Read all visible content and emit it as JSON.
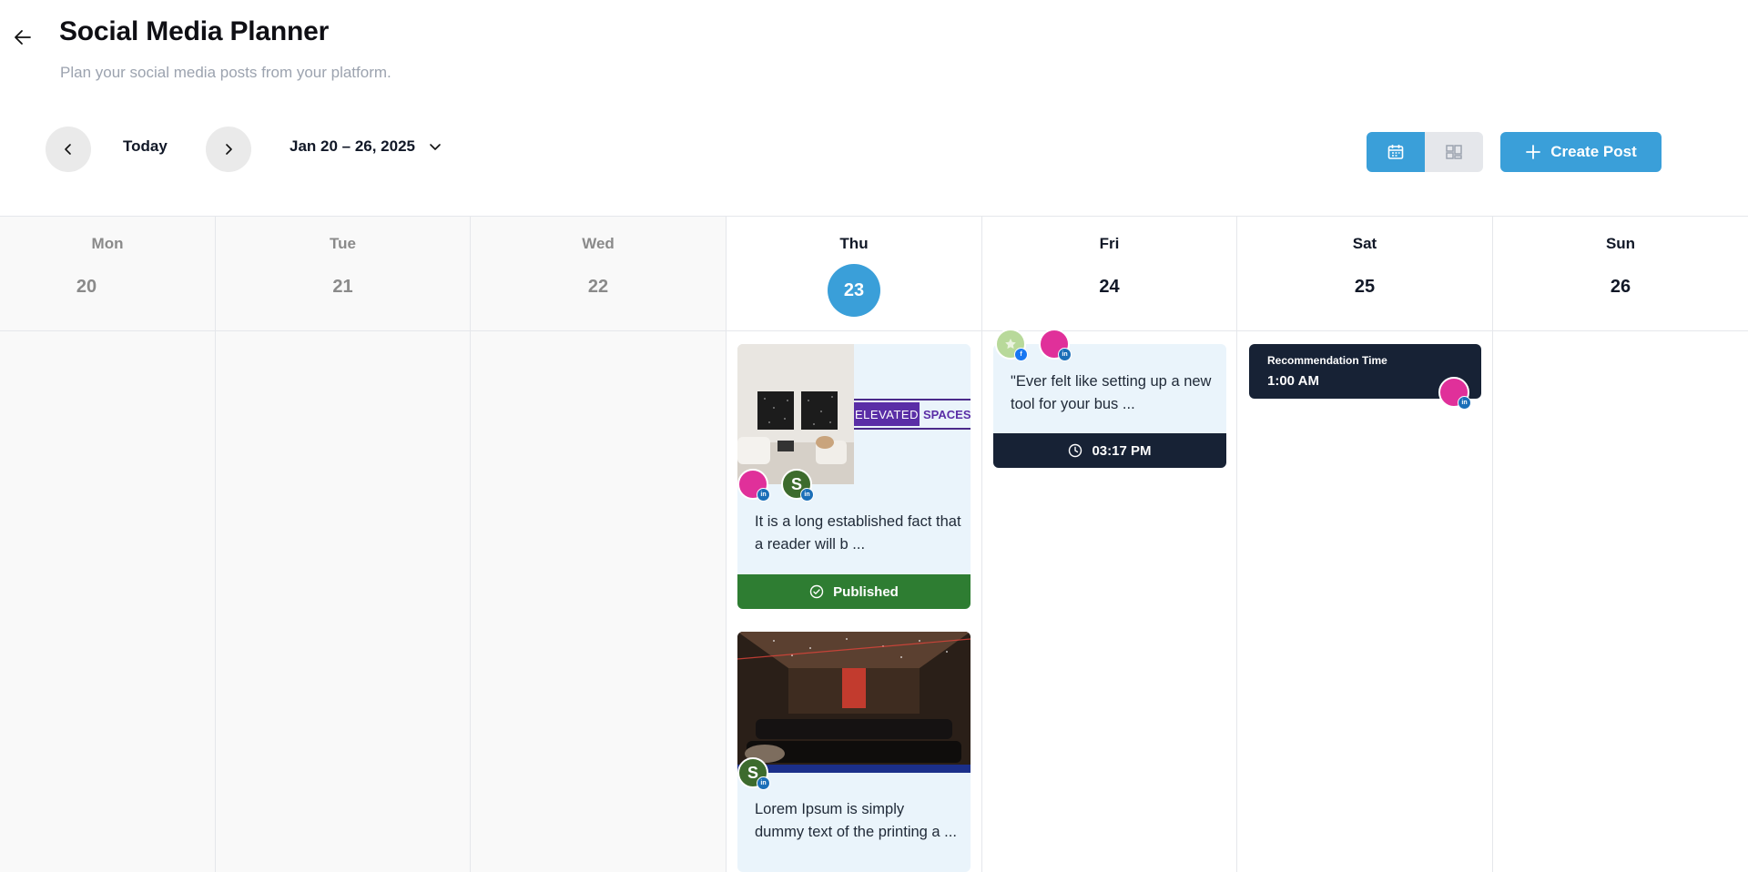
{
  "header": {
    "title": "Social Media Planner",
    "subtitle": "Plan your social media posts from your platform.",
    "back_icon": "arrow-left-icon"
  },
  "toolbar": {
    "today_label": "Today",
    "date_range": "Jan 20 – 26, 2025",
    "create_label": "Create Post",
    "views": [
      "calendar-view",
      "grid-view"
    ],
    "active_view": "calendar-view",
    "accent_color": "#3a9fd9"
  },
  "days": [
    {
      "name": "Mon",
      "num": "20",
      "past": true
    },
    {
      "name": "Tue",
      "num": "21",
      "past": true
    },
    {
      "name": "Wed",
      "num": "22",
      "past": true
    },
    {
      "name": "Thu",
      "num": "23",
      "today": true
    },
    {
      "name": "Fri",
      "num": "24"
    },
    {
      "name": "Sat",
      "num": "25"
    },
    {
      "name": "Sun",
      "num": "26"
    }
  ],
  "posts": [
    {
      "day": "Thu",
      "brand_text_1": "ELEVATED",
      "brand_text_2": "SPACES",
      "avatars": [
        {
          "color": "#e0309a",
          "network": "in"
        },
        {
          "initial": "S",
          "color": "#3d6b2d",
          "network": "in"
        }
      ],
      "text": "It is a long established fact that a reader will b ...",
      "status": "Published",
      "status_color": "#2e7d32"
    },
    {
      "day": "Thu",
      "avatars": [
        {
          "initial": "S",
          "color": "#3d6b2d",
          "network": "in"
        }
      ],
      "text": "Lorem Ipsum is simply dummy text of the printing a ..."
    },
    {
      "day": "Fri",
      "avatars": [
        {
          "color": "#b8d99a",
          "network": "f"
        },
        {
          "color": "#e0309a",
          "network": "in"
        }
      ],
      "text": "\"Ever felt like setting up a new tool for your bus ...",
      "scheduled_time": "03:17 PM",
      "status_color": "#172235"
    }
  ],
  "recommendation": {
    "day": "Sat",
    "label": "Recommendation Time",
    "time": "1:00 AM",
    "avatar": {
      "color": "#e0309a",
      "network": "in"
    }
  },
  "avatar_initial": "S",
  "network_label": "in",
  "facebook_label": "f"
}
